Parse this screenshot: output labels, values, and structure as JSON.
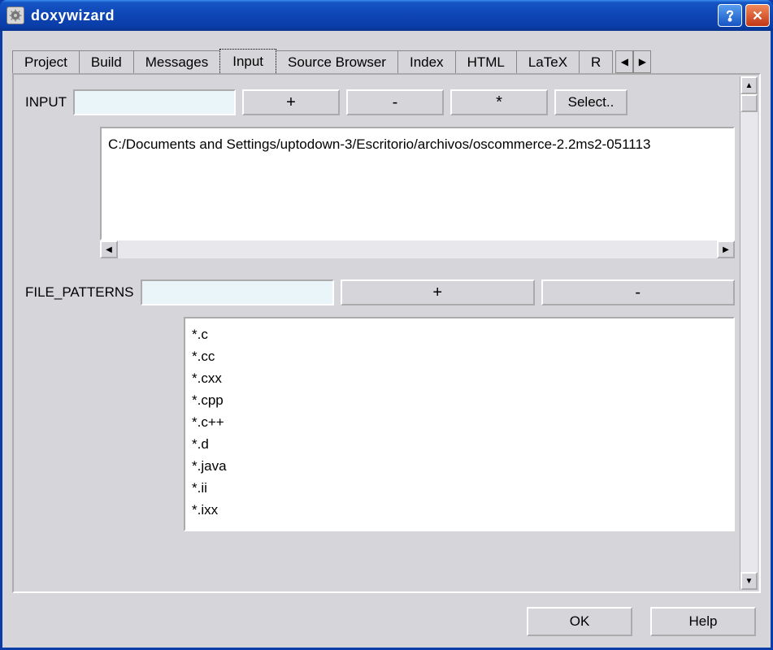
{
  "window": {
    "title": "doxywizard"
  },
  "tabs": [
    "Project",
    "Build",
    "Messages",
    "Input",
    "Source Browser",
    "Index",
    "HTML",
    "LaTeX",
    "R"
  ],
  "active_tab": "Input",
  "input_section": {
    "label": "INPUT",
    "add_label": "+",
    "remove_label": "-",
    "update_label": "*",
    "select_label": "Select..",
    "items": [
      "C:/Documents and Settings/uptodown-3/Escritorio/archivos/oscommerce-2.2ms2-051113"
    ]
  },
  "file_patterns_section": {
    "label": "FILE_PATTERNS",
    "add_label": "+",
    "remove_label": "-",
    "items": [
      "*.c",
      "*.cc",
      "*.cxx",
      "*.cpp",
      "*.c++",
      "*.d",
      "*.java",
      "*.ii",
      "*.ixx"
    ]
  },
  "buttons": {
    "ok": "OK",
    "help": "Help"
  }
}
